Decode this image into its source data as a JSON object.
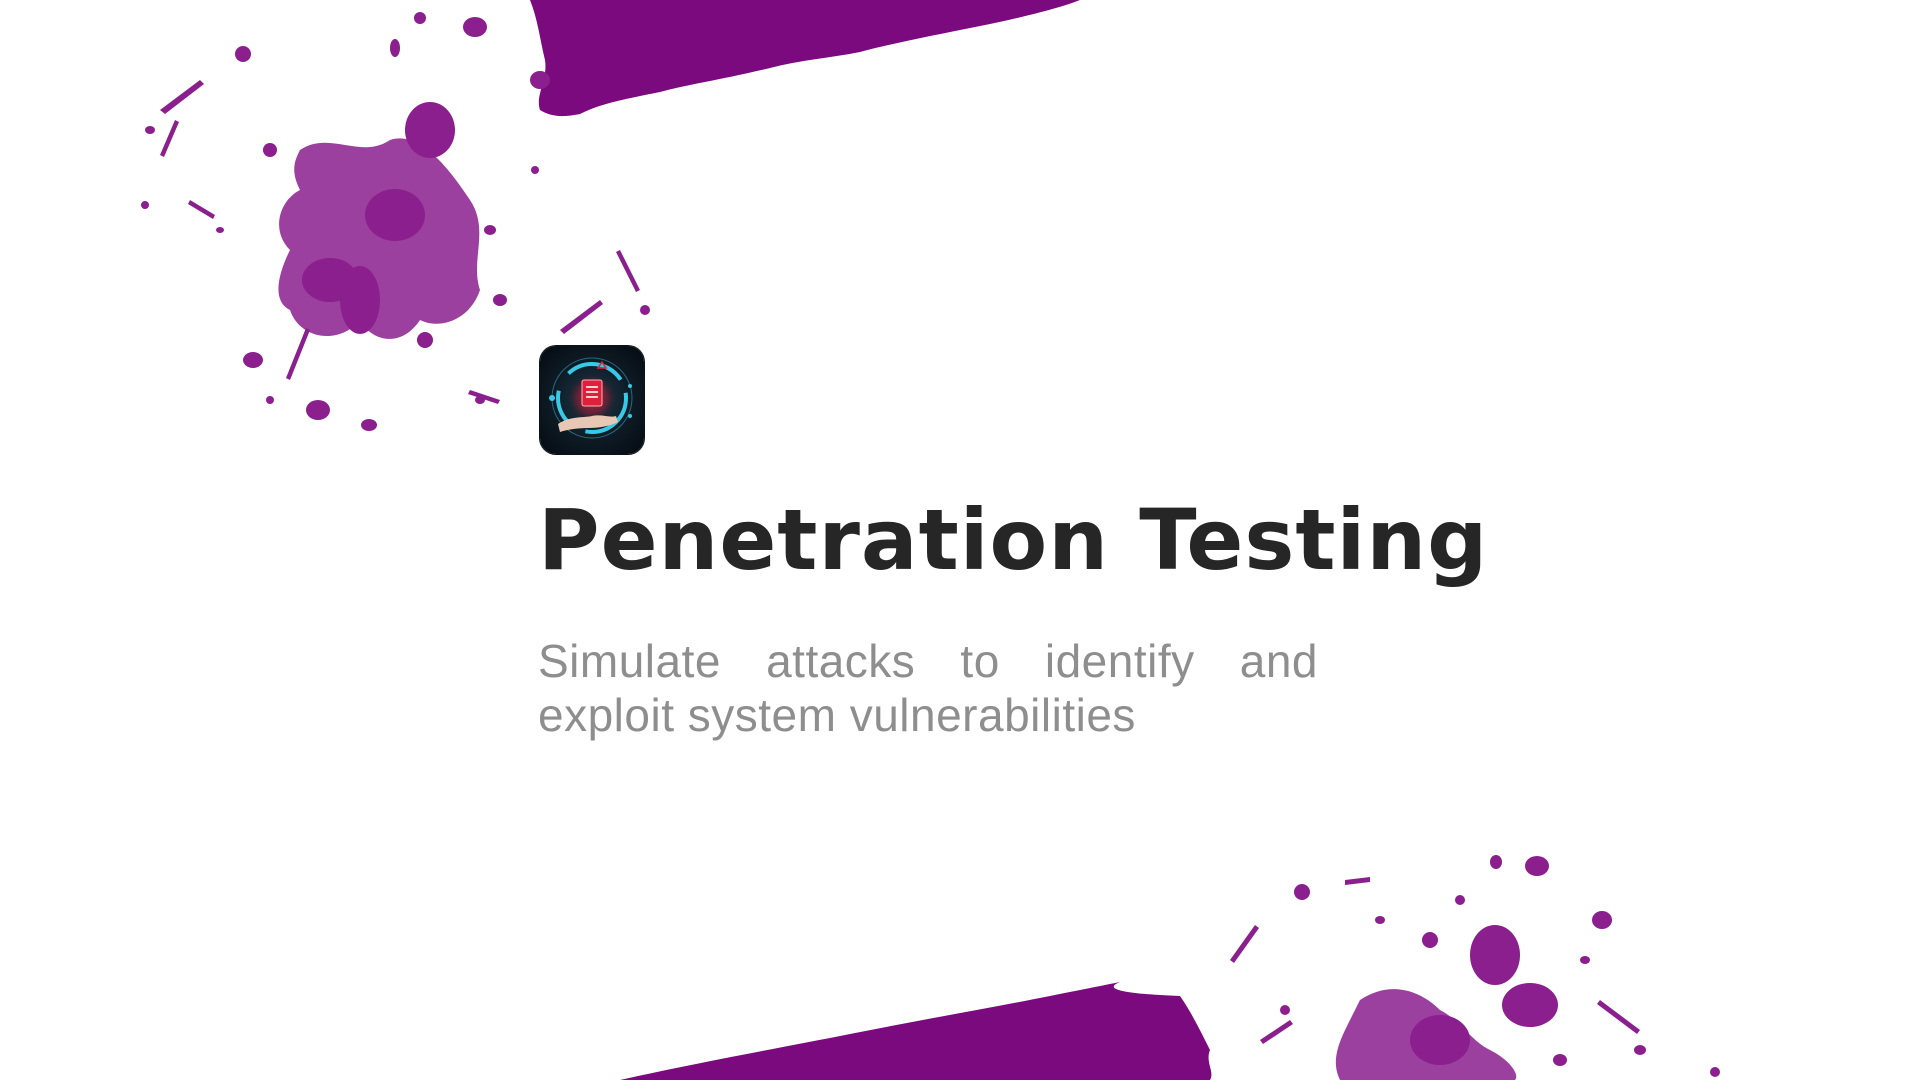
{
  "slide": {
    "title": "Penetration Testing",
    "subtitle": "Simulate attacks to identify and exploit system vulnerabilities"
  },
  "icons": {
    "app": "security-hand-shield-icon"
  },
  "colors": {
    "accent": "#7b0a7e",
    "splash": "#8a1f8d",
    "title": "#262626",
    "subtitle": "#8e8e8e",
    "background": "#ffffff"
  }
}
